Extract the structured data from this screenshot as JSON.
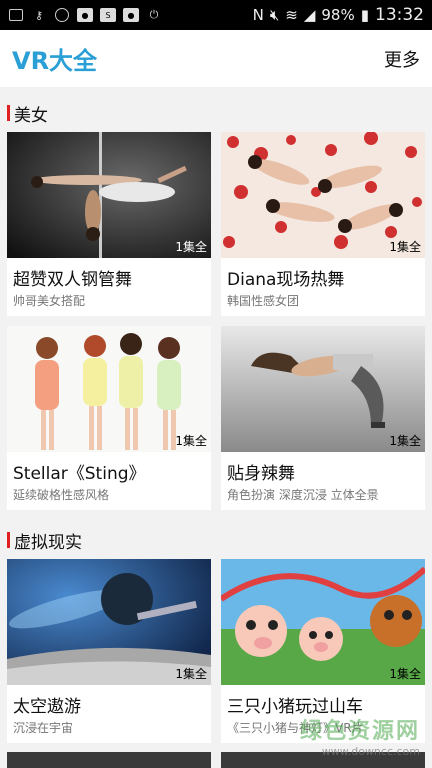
{
  "status_bar": {
    "battery": "98%",
    "time": "13:32"
  },
  "header": {
    "title": "VR大全",
    "more_label": "更多"
  },
  "sections": [
    {
      "title": "美女",
      "items": [
        {
          "title": "超赞双人钢管舞",
          "subtitle": "帅哥美女搭配",
          "badge": "1集全"
        },
        {
          "title": "Diana现场热舞",
          "subtitle": "韩国性感女团",
          "badge": "1集全"
        },
        {
          "title": "Stellar《Sting》",
          "subtitle": "延续破格性感风格",
          "badge": "1集全"
        },
        {
          "title": "贴身辣舞",
          "subtitle": "角色扮演 深度沉浸 立体全景",
          "badge": "1集全"
        }
      ]
    },
    {
      "title": "虚拟现实",
      "items": [
        {
          "title": "太空遨游",
          "subtitle": "沉浸在宇宙",
          "badge": "1集全"
        },
        {
          "title": "三只小猪玩过山车",
          "subtitle": "《三只小猪与神灯》VR片",
          "badge": "1集全"
        }
      ]
    }
  ],
  "watermark": {
    "line1": "绿色资源网",
    "line2": "www.downcc.com"
  }
}
